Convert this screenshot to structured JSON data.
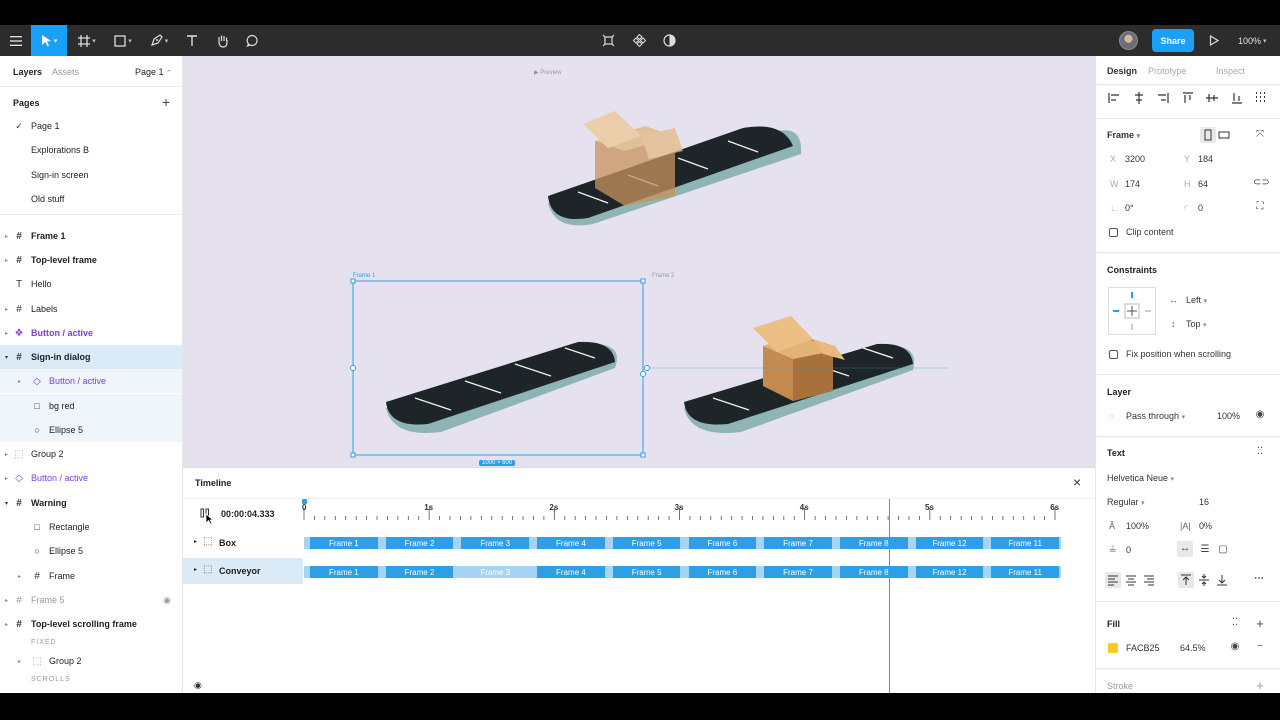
{
  "toolbar": {
    "share_label": "Share",
    "zoom": "100%"
  },
  "left": {
    "tab_layers": "Layers",
    "tab_assets": "Assets",
    "page_selector": "Page 1",
    "pages_heading": "Pages",
    "pages": [
      "Page 1",
      "Explorations B",
      "Sign-in screen",
      "Old stuff"
    ],
    "layers": [
      {
        "label": "Frame 1"
      },
      {
        "label": "Top-level frame"
      },
      {
        "label": "Hello"
      },
      {
        "label": "Labels"
      },
      {
        "label": "Button / active"
      },
      {
        "label": "Sign-in dialog"
      },
      {
        "label": "Button / active"
      },
      {
        "label": "bg red"
      },
      {
        "label": "Ellipse 5"
      },
      {
        "label": "Group 2"
      },
      {
        "label": "Button / active"
      },
      {
        "label": "Warning"
      },
      {
        "label": "Rectangle"
      },
      {
        "label": "Ellipse 5"
      },
      {
        "label": "Frame"
      },
      {
        "label": "Frame 5"
      },
      {
        "label": "Top-level scrolling frame"
      },
      {
        "label": "FIXED"
      },
      {
        "label": "Group 2"
      },
      {
        "label": "SCROLLS"
      }
    ]
  },
  "canvas": {
    "preview_label": "▶ Preview",
    "frame1_label": "Frame 1",
    "frame2_label": "Frame 2",
    "size_badge": "1000 × 600"
  },
  "timeline": {
    "title": "Timeline",
    "timecode": "00:00:04.333",
    "ticks": [
      "0",
      "1s",
      "2s",
      "3s",
      "4s",
      "5s",
      "6s"
    ],
    "tracks": [
      {
        "name": "Box",
        "clips": [
          "Frame 1",
          "Frame 2",
          "Frame 3",
          "Frame 4",
          "Frame 5",
          "Frame 6",
          "Frame 7",
          "Frame 8",
          "Frame 12",
          "Frame 11"
        ]
      },
      {
        "name": "Conveyor",
        "clips": [
          "Frame 1",
          "Frame 2",
          "Frame 3",
          "Frame 4",
          "Frame 5",
          "Frame 6",
          "Frame 7",
          "Frame 8",
          "Frame 12",
          "Frame 11"
        ]
      }
    ]
  },
  "right": {
    "tab_design": "Design",
    "tab_prototype": "Prototype",
    "tab_inspect": "Inspect",
    "frame_label": "Frame",
    "x_label": "X",
    "x": "3200",
    "y_label": "Y",
    "y": "184",
    "w_label": "W",
    "w": "174",
    "h_label": "H",
    "h": "64",
    "rotation": "0°",
    "radius": "0",
    "clip_content": "Clip content",
    "constraints_heading": "Constraints",
    "constraint_h": "Left",
    "constraint_v": "Top",
    "fix_position": "Fix position when scrolling",
    "layer_heading": "Layer",
    "blend": "Pass through",
    "opacity": "100%",
    "text_heading": "Text",
    "font_family": "Helvetica Neue",
    "font_weight": "Regular",
    "font_size": "16",
    "line_height": "100%",
    "letter_spacing": "0%",
    "paragraph_spacing": "0",
    "fill_heading": "Fill",
    "fill_hex": "FACB25",
    "fill_opacity": "64.5%",
    "fill_color": "#FACB25",
    "stroke_heading": "Stroke"
  }
}
